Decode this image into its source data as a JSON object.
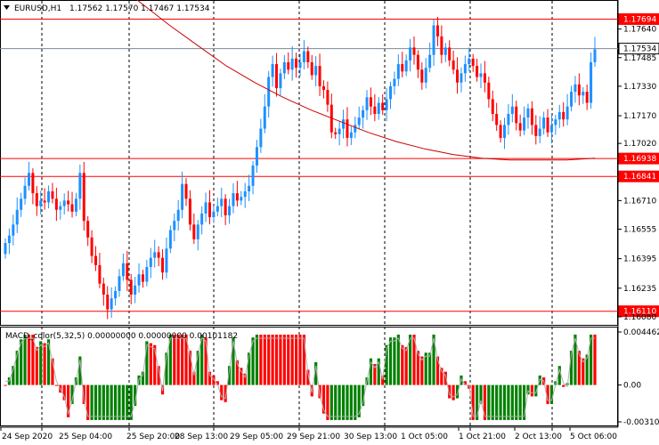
{
  "header": {
    "dropdown_icon": "triangle-down-icon",
    "symbol": "EURUSD,H1",
    "ohlc": "1.17562 1.17570 1.17467 1.17534"
  },
  "indicator": {
    "label": "MACD_color(5,32,5) 0.00000000 0.00000000 0.00101182",
    "axis_labels": [
      "0.0044622",
      "0.00",
      "-0.003103"
    ]
  },
  "price_axis": {
    "labels": [
      "1.17640",
      "1.17485",
      "1.17330",
      "1.17170",
      "1.17020",
      "1.16710",
      "1.16555",
      "1.16395",
      "1.16235",
      "1.16080"
    ]
  },
  "level_labels": [
    {
      "value": "1.17694",
      "color": "#ff0000"
    },
    {
      "value": "1.17534",
      "color": "#000000"
    },
    {
      "value": "1.16938",
      "color": "#ff0000"
    },
    {
      "value": "1.16841",
      "color": "#ff0000"
    },
    {
      "value": "1.16110",
      "color": "#ff0000"
    }
  ],
  "time_axis": {
    "labels": [
      "24 Sep 2020",
      "25 Sep 04:00",
      "25 Sep 20:00",
      "28 Sep 13:00",
      "29 Sep 05:00",
      "29 Sep 21:00",
      "30 Sep 13:00",
      "1 Oct 05:00",
      "1 Oct 21:00",
      "2 Oct 13:00",
      "5 Oct 06:00"
    ]
  },
  "colors": {
    "bull": "#1e90ff",
    "bear": "#ff0000",
    "ma": "#cc0000",
    "level": "#ff0000",
    "hist_up": "#008000",
    "hist_down": "#ff0000"
  },
  "chart_data": {
    "type": "candlestick",
    "price_series_close": [
      1.1648,
      1.1652,
      1.1658,
      1.1666,
      1.1672,
      1.1679,
      1.1686,
      1.1675,
      1.1668,
      1.1671,
      1.167,
      1.1676,
      1.1672,
      1.1666,
      1.1668,
      1.1671,
      1.1669,
      1.1665,
      1.1672,
      1.1686,
      1.166,
      1.1651,
      1.1641,
      1.1636,
      1.1626,
      1.162,
      1.1612,
      1.1618,
      1.1622,
      1.163,
      1.1637,
      1.1628,
      1.162,
      1.1625,
      1.1631,
      1.1627,
      1.1635,
      1.164,
      1.1643,
      1.164,
      1.1632,
      1.1645,
      1.1655,
      1.166,
      1.1666,
      1.168,
      1.1672,
      1.1658,
      1.165,
      1.1658,
      1.1664,
      1.167,
      1.1662,
      1.1665,
      1.1668,
      1.1672,
      1.1663,
      1.1668,
      1.1675,
      1.1671,
      1.1673,
      1.1676,
      1.1679,
      1.169,
      1.17,
      1.171,
      1.1722,
      1.1738,
      1.1745,
      1.1732,
      1.174,
      1.1746,
      1.1742,
      1.1748,
      1.1743,
      1.1746,
      1.1752,
      1.1746,
      1.1739,
      1.1744,
      1.1733,
      1.1731,
      1.1723,
      1.1708,
      1.1707,
      1.171,
      1.1715,
      1.1705,
      1.1708,
      1.1712,
      1.1716,
      1.172,
      1.1727,
      1.1722,
      1.1718,
      1.1724,
      1.172,
      1.1726,
      1.1733,
      1.1737,
      1.1745,
      1.1741,
      1.1747,
      1.1754,
      1.175,
      1.1742,
      1.1735,
      1.1743,
      1.175,
      1.1766,
      1.176,
      1.175,
      1.1754,
      1.1747,
      1.1742,
      1.1735,
      1.174,
      1.1745,
      1.1748,
      1.1744,
      1.1738,
      1.174,
      1.1735,
      1.1726,
      1.1718,
      1.1712,
      1.1705,
      1.1712,
      1.1718,
      1.1722,
      1.1713,
      1.1709,
      1.1716,
      1.1721,
      1.1712,
      1.1706,
      1.171,
      1.1716,
      1.1708,
      1.1712,
      1.1715,
      1.1719,
      1.1715,
      1.1722,
      1.173,
      1.1734,
      1.1728,
      1.173,
      1.1724,
      1.1746,
      1.1753
    ],
    "ma_series": [
      1.1801,
      1.179,
      1.1778,
      1.1766,
      1.1755,
      1.1744,
      1.1735,
      1.1727,
      1.172,
      1.1714,
      1.1708,
      1.1703,
      1.1699,
      1.1696,
      1.1694,
      1.1693,
      1.1693,
      1.1693,
      1.1694
    ],
    "levels": [
      1.17694,
      1.17534,
      1.16938,
      1.16841,
      1.1611
    ],
    "price_range": [
      1.1607,
      1.1773
    ],
    "macd_range": [
      -0.003103,
      0.0044622
    ],
    "grid": "vertical-dashed"
  }
}
